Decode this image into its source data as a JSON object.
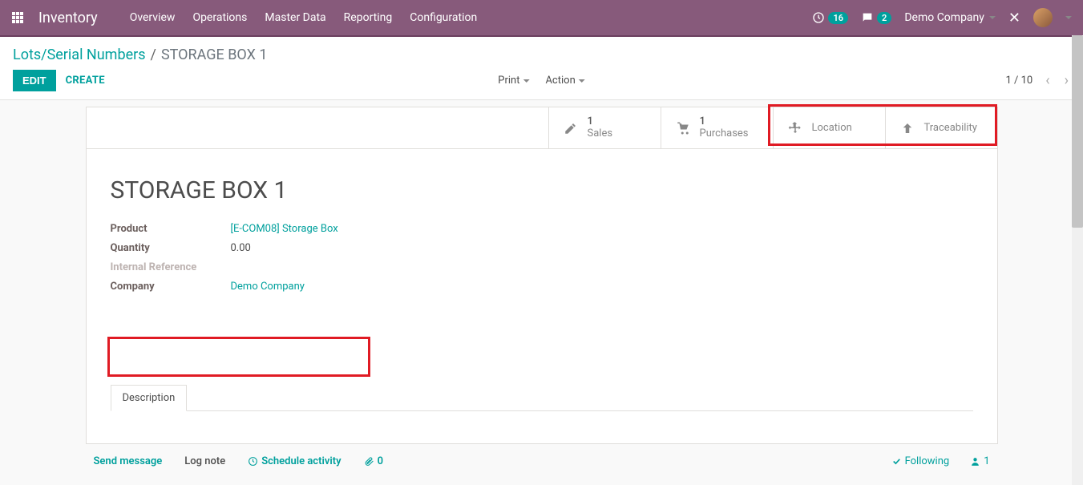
{
  "navbar": {
    "brand": "Inventory",
    "menu": [
      "Overview",
      "Operations",
      "Master Data",
      "Reporting",
      "Configuration"
    ],
    "activities_count": "16",
    "messages_count": "2",
    "company": "Demo Company"
  },
  "breadcrumb": {
    "parent": "Lots/Serial Numbers",
    "current": "STORAGE BOX 1"
  },
  "toolbar": {
    "edit": "EDIT",
    "create": "CREATE",
    "print": "Print",
    "action": "Action",
    "pager": "1 / 10"
  },
  "stat_buttons": {
    "sales": {
      "count": "1",
      "label": "Sales"
    },
    "purchases": {
      "count": "1",
      "label": "Purchases"
    },
    "location": {
      "label": "Location"
    },
    "traceability": {
      "label": "Traceability"
    }
  },
  "record": {
    "title": "STORAGE BOX 1",
    "fields": {
      "product_label": "Product",
      "product_value": "[E-COM08] Storage Box",
      "quantity_label": "Quantity",
      "quantity_value": "0.00",
      "internal_ref_label": "Internal Reference",
      "company_label": "Company",
      "company_value": "Demo Company"
    },
    "tabs": {
      "description": "Description"
    }
  },
  "chatter": {
    "send_message": "Send message",
    "log_note": "Log note",
    "schedule_activity": "Schedule activity",
    "attachments": "0",
    "following": "Following",
    "followers": "1"
  }
}
